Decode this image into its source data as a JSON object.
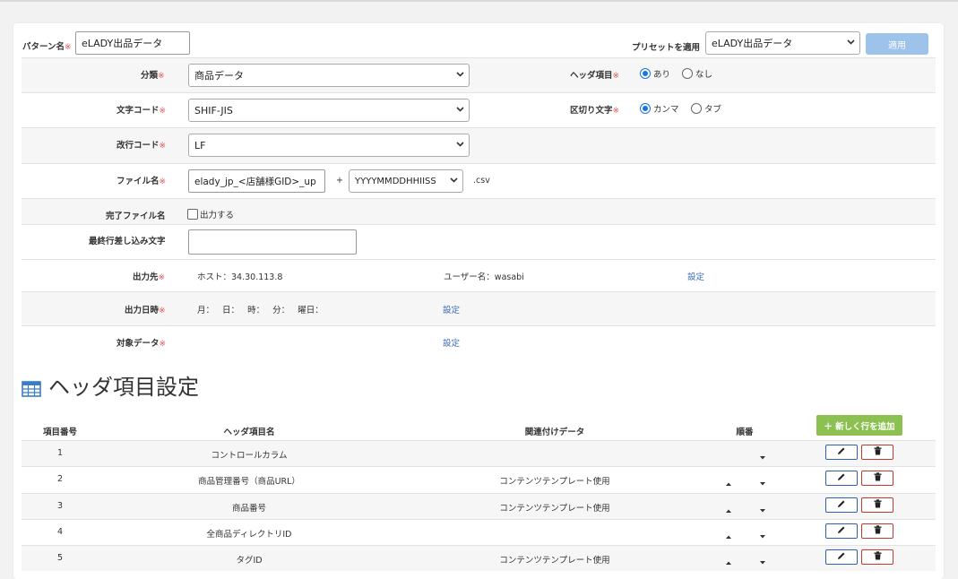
{
  "form": {
    "pattern_name_label": "パターン名",
    "pattern_name_value": "eLADY出品データ",
    "preset_label": "プリセットを適用",
    "preset_value": "eLADY出品データ",
    "apply_label": "適用",
    "required_mark": "※",
    "category_label": "分類",
    "category_value": "商品データ",
    "header_item_label": "ヘッダ項目",
    "header_opt_yes": "あり",
    "header_opt_no": "なし",
    "charset_label": "文字コード",
    "charset_value": "SHIF-JIS",
    "delimiter_label": "区切り文字",
    "delimiter_comma": "カンマ",
    "delimiter_tab": "タブ",
    "newline_label": "改行コード",
    "newline_value": "LF",
    "filename_label": "ファイル名",
    "filename_value": "elady_jp_<店舗様GID>_up",
    "filename_plus": "+",
    "filename_date_value": "YYYYMMDDHHIISS",
    "filename_ext": ".csv",
    "complete_file_label": "完了ファイル名",
    "complete_file_option": "出力する",
    "last_line_label": "最終行差し込み文字",
    "last_line_value": "",
    "output_dest_label": "出力先",
    "host_text": "ホスト：34.30.113.8",
    "user_text": "ユーザー名：wasabi",
    "output_dest_link": "設定",
    "output_time_label": "出力日時",
    "output_time_text": "月：   日：   時：   分：   曜日：",
    "output_time_link": "設定",
    "target_data_label": "対象データ",
    "target_data_link": "設定"
  },
  "header_section": {
    "title": "ヘッダ項目設定",
    "col_no": "項目番号",
    "col_name": "ヘッダ項目名",
    "col_related": "関連付けデータ",
    "col_order": "順番",
    "add_row_label": "＋ 新しく行を追加",
    "rows": [
      {
        "no": "1",
        "name": "コントロールカラム",
        "related": ""
      },
      {
        "no": "2",
        "name": "商品管理番号（商品URL）",
        "related": "コンテンツテンプレート使用"
      },
      {
        "no": "3",
        "name": "商品番号",
        "related": "コンテンツテンプレート使用"
      },
      {
        "no": "4",
        "name": "全商品ディレクトリID",
        "related": ""
      },
      {
        "no": "5",
        "name": "タグID",
        "related": "コンテンツテンプレート使用"
      }
    ]
  },
  "colors": {
    "accent": "#1a73e8",
    "apply_button": "#9dc3ea",
    "add_button": "#8cc152",
    "required": "#d9534f",
    "link": "#3b6fb6"
  }
}
